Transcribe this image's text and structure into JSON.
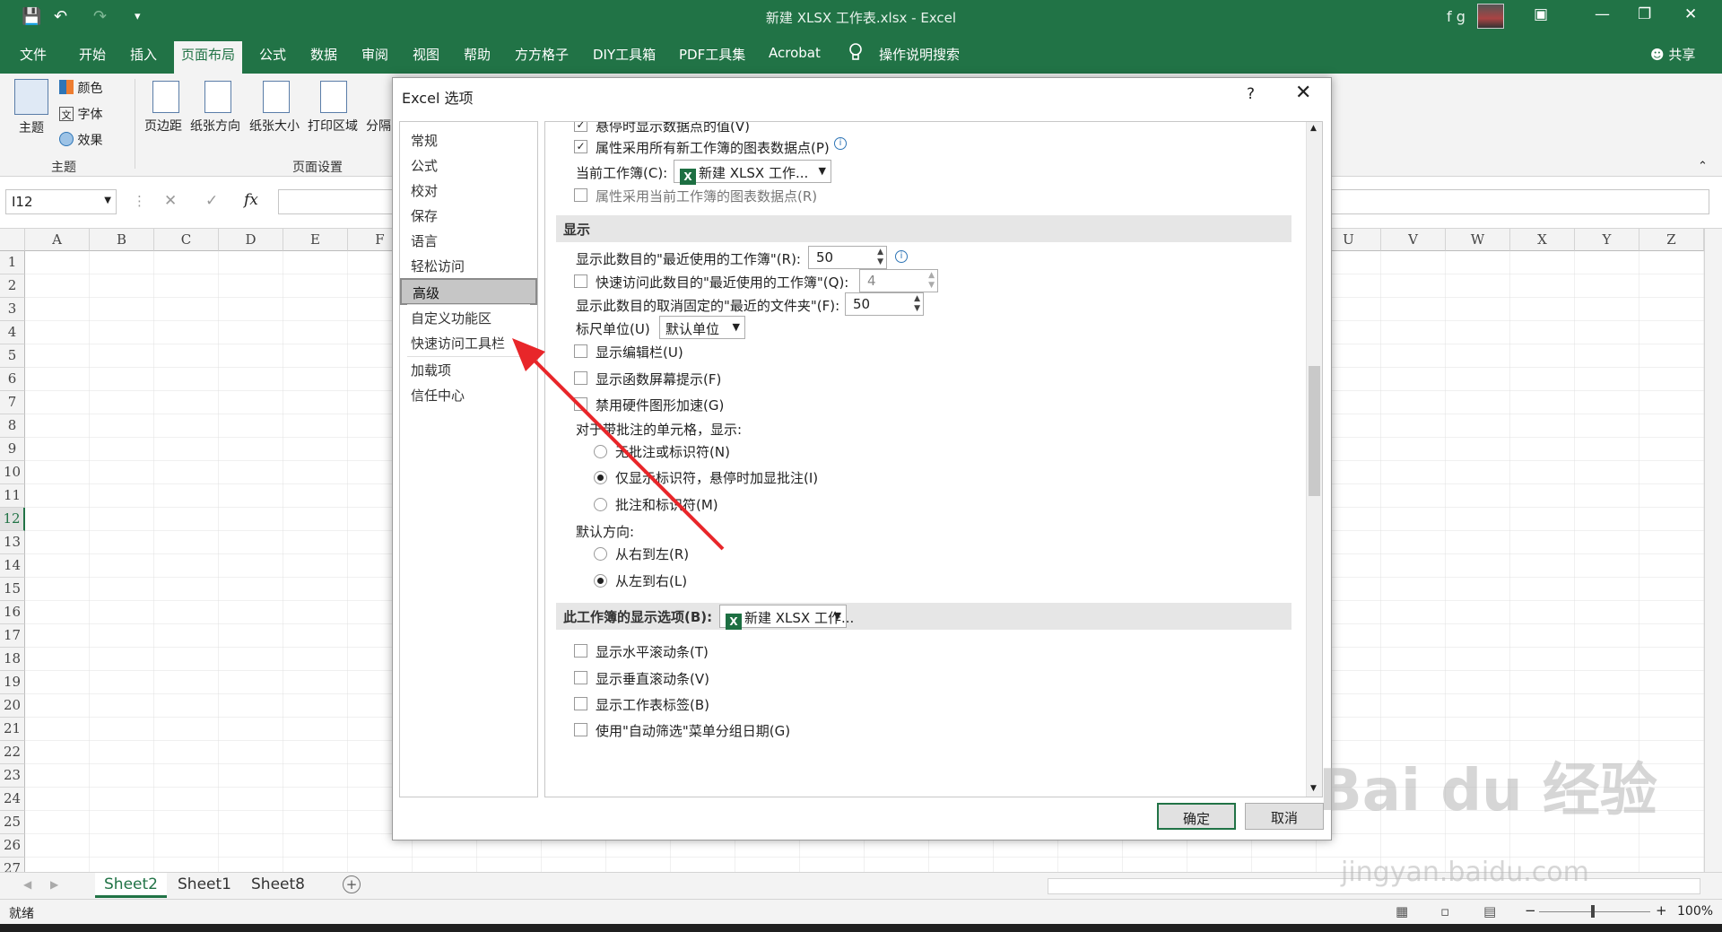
{
  "window": {
    "title": "新建 XLSX 工作表.xlsx  -  Excel",
    "user": "f g"
  },
  "tabs": [
    "文件",
    "开始",
    "插入",
    "页面布局",
    "公式",
    "数据",
    "审阅",
    "视图",
    "帮助",
    "方方格子",
    "DIY工具箱",
    "PDF工具集",
    "Acrobat"
  ],
  "active_tab": "页面布局",
  "tell_me": "操作说明搜索",
  "share": "共享",
  "ribbon": {
    "theme_label": "主题",
    "colors": "颜色",
    "fonts": "字体",
    "effects": "效果",
    "group_theme": "主题",
    "margins": "页边距",
    "orientation": "纸张方向",
    "size": "纸张大小",
    "print_area": "打印区域",
    "breaks": "分隔",
    "group_page_setup": "页面设置"
  },
  "namebox": "I12",
  "fx": "fx",
  "columns_left": [
    "A",
    "B",
    "C",
    "D",
    "E",
    "F"
  ],
  "columns_right": [
    "U",
    "V",
    "W",
    "X",
    "Y",
    "Z"
  ],
  "rows": [
    "1",
    "2",
    "3",
    "4",
    "5",
    "6",
    "7",
    "8",
    "9",
    "10",
    "11",
    "12",
    "13",
    "14",
    "15",
    "16",
    "17",
    "18",
    "19",
    "20",
    "21",
    "22",
    "23",
    "24",
    "25",
    "26",
    "27"
  ],
  "sheets": [
    "Sheet2",
    "Sheet1",
    "Sheet8"
  ],
  "status": {
    "ready": "就绪",
    "zoom": "100%"
  },
  "dialog": {
    "title": "Excel 选项",
    "help": "?",
    "categories": [
      "常规",
      "公式",
      "校对",
      "保存",
      "语言",
      "轻松访问",
      "高级",
      "自定义功能区",
      "快速访问工具栏",
      "加载项",
      "信任中心"
    ],
    "active_category": "高级",
    "options": {
      "hover_values": "悬停时显示数据点的值(V)",
      "props_all_new": "属性采用所有新工作簿的图表数据点(P)",
      "current_wb_label": "当前工作簿(C):",
      "current_wb_value": "新建 XLSX 工作...",
      "props_current": "属性采用当前工作簿的图表数据点(R)",
      "section_display": "显示",
      "recent_wb_label": "显示此数目的\"最近使用的工作簿\"(R):",
      "recent_wb_value": "50",
      "quick_access_label": "快速访问此数目的\"最近使用的工作簿\"(Q):",
      "quick_access_value": "4",
      "recent_folders_label": "显示此数目的取消固定的\"最近的文件夹\"(F):",
      "recent_folders_value": "50",
      "ruler_label": "标尺单位(U)",
      "ruler_value": "默认单位",
      "show_formula_bar": "显示编辑栏(U)",
      "show_func_tips": "显示函数屏幕提示(F)",
      "disable_hw_accel": "禁用硬件图形加速(G)",
      "comments_label": "对于带批注的单元格，显示:",
      "no_comments": "无批注或标识符(N)",
      "indicators_only": "仅显示标识符，悬停时加显批注(I)",
      "comments_and_ind": "批注和标识符(M)",
      "direction_label": "默认方向:",
      "rtl": "从右到左(R)",
      "ltr": "从左到右(L)",
      "section_wb_display": "此工作簿的显示选项(B):",
      "wb_display_value": "新建 XLSX 工作...",
      "show_hscroll": "显示水平滚动条(T)",
      "show_vscroll": "显示垂直滚动条(V)",
      "show_sheet_tabs": "显示工作表标签(B)",
      "group_dates": "使用\"自动筛选\"菜单分组日期(G)"
    },
    "ok": "确定",
    "cancel": "取消"
  },
  "watermark": {
    "brand": "Bai du 经验",
    "url": "jingyan.baidu.com"
  },
  "colors": {
    "excel_green": "#217346",
    "arrow_red": "#e8262a"
  }
}
